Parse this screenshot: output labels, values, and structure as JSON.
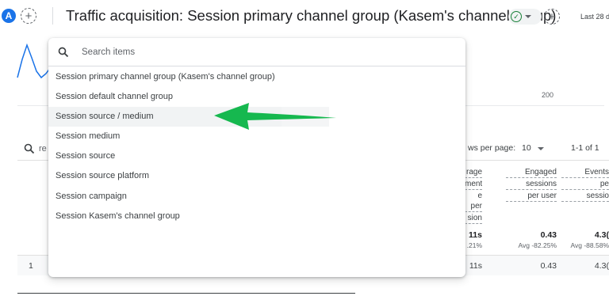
{
  "header": {
    "avatar_letter": "A",
    "title": "Traffic acquisition: Session primary channel group (Kasem's channel group)",
    "date_range": "Last 28 d"
  },
  "chart": {
    "axis_label": "200"
  },
  "table_controls": {
    "search_placeholder": "re",
    "rows_per_page_label": "ws per page:",
    "rows_per_page_value": "10",
    "pagination": "1-1 of 1"
  },
  "columns": [
    {
      "label_lines": [
        "rage",
        "ment",
        "e per",
        "sion"
      ]
    },
    {
      "label_lines": [
        "Engaged",
        "sessions",
        "per user"
      ]
    },
    {
      "label_lines": [
        "Events",
        "pe",
        "sessio"
      ]
    }
  ],
  "totals": {
    "values": [
      "11s",
      "0.43",
      "4.3("
    ],
    "subs": [
      ".21%",
      "Avg -82.25%",
      "Avg -88.58%"
    ]
  },
  "row1": {
    "index": "1",
    "values": [
      "11s",
      "0.43",
      "4.3("
    ]
  },
  "dropdown": {
    "search_placeholder": "Search items",
    "items": [
      "Session primary channel group (Kasem's channel group)",
      "Session default channel group",
      "Session source / medium",
      "Session medium",
      "Session source",
      "Session source platform",
      "Session campaign",
      "Session Kasem's channel group"
    ],
    "highlighted_index": 2
  },
  "colors": {
    "accent_blue": "#1a73e8",
    "arrow_green": "#16b84f",
    "hover_gray": "#f1f3f4"
  }
}
